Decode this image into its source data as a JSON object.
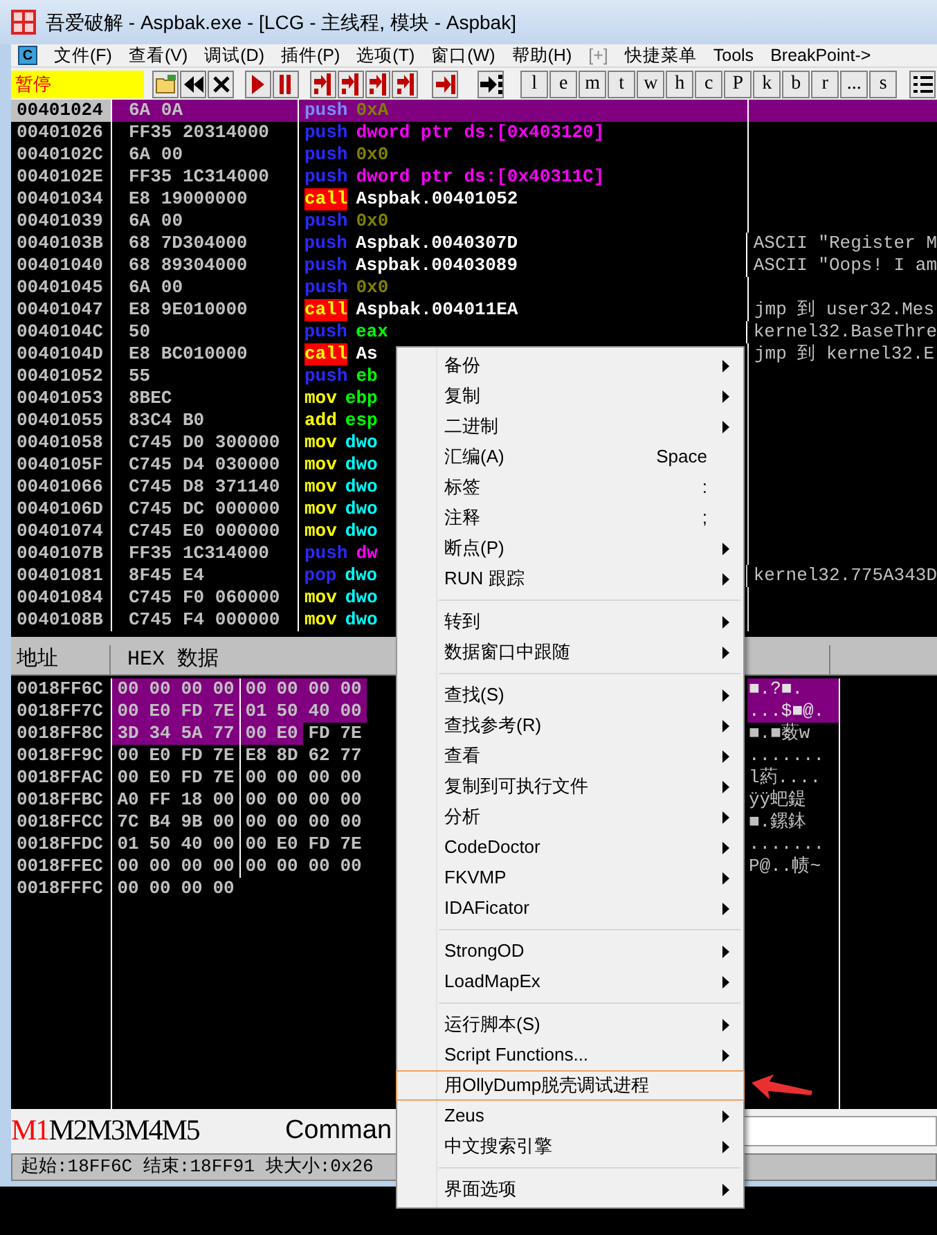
{
  "window": {
    "title": "吾爱破解 - Aspbak.exe - [LCG -  主线程, 模块 - Aspbak]"
  },
  "menu_bar": {
    "icon_letter": "C",
    "items": [
      {
        "label": "文件(F)",
        "disabled": false
      },
      {
        "label": "查看(V)",
        "disabled": false
      },
      {
        "label": "调试(D)",
        "disabled": false
      },
      {
        "label": "插件(P)",
        "disabled": false
      },
      {
        "label": "选项(T)",
        "disabled": false
      },
      {
        "label": "窗口(W)",
        "disabled": false
      },
      {
        "label": "帮助(H)",
        "disabled": false
      },
      {
        "label": "[+]",
        "disabled": true
      },
      {
        "label": "快捷菜单",
        "disabled": false
      },
      {
        "label": "Tools",
        "disabled": false
      },
      {
        "label": "BreakPoint->",
        "disabled": false
      }
    ]
  },
  "toolbar": {
    "status": "暂停",
    "buttons": [
      {
        "kind": "open"
      },
      {
        "kind": "rewind"
      },
      {
        "kind": "close"
      },
      {
        "kind": "run"
      },
      {
        "kind": "pause"
      },
      {
        "kind": "step_into"
      },
      {
        "kind": "step_over"
      },
      {
        "kind": "trace_into"
      },
      {
        "kind": "trace_over"
      },
      {
        "kind": "till_return"
      },
      {
        "kind": "goto"
      },
      {
        "kind": "letter",
        "label": "l"
      },
      {
        "kind": "letter",
        "label": "e"
      },
      {
        "kind": "letter",
        "label": "m"
      },
      {
        "kind": "letter",
        "label": "t"
      },
      {
        "kind": "letter",
        "label": "w"
      },
      {
        "kind": "letter",
        "label": "h"
      },
      {
        "kind": "letter",
        "label": "c"
      },
      {
        "kind": "letter",
        "label": "P"
      },
      {
        "kind": "letter",
        "label": "k"
      },
      {
        "kind": "letter",
        "label": "b"
      },
      {
        "kind": "letter",
        "label": "r"
      },
      {
        "kind": "letter",
        "label": "..."
      },
      {
        "kind": "letter",
        "label": "s"
      },
      {
        "kind": "list"
      }
    ]
  },
  "disassembly": {
    "rows": [
      {
        "address": "00401024",
        "hex": "6A 0A",
        "mnemonic": {
          "text": "push",
          "kind": "stack"
        },
        "operand": {
          "text": "0xA",
          "kind": "imm"
        },
        "selected": true
      },
      {
        "address": "00401026",
        "hex": "FF35 20314000",
        "mnemonic": {
          "text": "push",
          "kind": "stack"
        },
        "operand": {
          "text": "dword ptr ds:[0x403120]",
          "kind": "mem"
        },
        "selected": false
      },
      {
        "address": "0040102C",
        "hex": "6A 00",
        "mnemonic": {
          "text": "push",
          "kind": "stack"
        },
        "operand": {
          "text": "0x0",
          "kind": "imm"
        },
        "selected": false
      },
      {
        "address": "0040102E",
        "hex": "FF35 1C314000",
        "mnemonic": {
          "text": "push",
          "kind": "stack"
        },
        "operand": {
          "text": "dword ptr ds:[0x40311C]",
          "kind": "mem"
        },
        "selected": false
      },
      {
        "address": "00401034",
        "hex": "E8 19000000",
        "mnemonic": {
          "text": "call",
          "kind": "call"
        },
        "operand": {
          "text": "Aspbak.00401052",
          "kind": "label"
        },
        "selected": false
      },
      {
        "address": "00401039",
        "hex": "6A 00",
        "mnemonic": {
          "text": "push",
          "kind": "stack"
        },
        "operand": {
          "text": "0x0",
          "kind": "imm"
        },
        "selected": false
      },
      {
        "address": "0040103B",
        "hex": "68 7D304000",
        "mnemonic": {
          "text": "push",
          "kind": "stack"
        },
        "operand": {
          "text": "Aspbak.0040307D",
          "kind": "label"
        },
        "comment": "ASCII \"Register M",
        "selected": false
      },
      {
        "address": "00401040",
        "hex": "68 89304000",
        "mnemonic": {
          "text": "push",
          "kind": "stack"
        },
        "operand": {
          "text": "Aspbak.00403089",
          "kind": "label"
        },
        "comment": "ASCII \"Oops! I am",
        "selected": false
      },
      {
        "address": "00401045",
        "hex": "6A 00",
        "mnemonic": {
          "text": "push",
          "kind": "stack"
        },
        "operand": {
          "text": "0x0",
          "kind": "imm"
        },
        "selected": false
      },
      {
        "address": "00401047",
        "hex": "E8 9E010000",
        "mnemonic": {
          "text": "call",
          "kind": "call"
        },
        "operand": {
          "text": "Aspbak.004011EA",
          "kind": "label"
        },
        "comment": "jmp 到 user32.Mes",
        "selected": false
      },
      {
        "address": "0040104C",
        "hex": "50",
        "mnemonic": {
          "text": "push",
          "kind": "stack"
        },
        "operand": {
          "text": "eax",
          "kind": "reg"
        },
        "comment": "kernel32.BaseThre",
        "selected": false
      },
      {
        "address": "0040104D",
        "hex": "E8 BC010000",
        "mnemonic": {
          "text": "call",
          "kind": "call"
        },
        "operand": {
          "text": "As",
          "kind": "label"
        },
        "comment": "jmp 到 kernel32.E",
        "selected": false
      },
      {
        "address": "00401052",
        "hex": "55",
        "mnemonic": {
          "text": "push",
          "kind": "stack"
        },
        "operand": {
          "text": "eb",
          "kind": "reg"
        },
        "selected": false
      },
      {
        "address": "00401053",
        "hex": "8BEC",
        "mnemonic": {
          "text": "mov",
          "kind": "arith"
        },
        "operand": {
          "text": "ebp",
          "kind": "reg"
        },
        "selected": false
      },
      {
        "address": "00401055",
        "hex": "83C4 B0",
        "mnemonic": {
          "text": "add",
          "kind": "arith"
        },
        "operand": {
          "text": "esp",
          "kind": "reg"
        },
        "selected": false
      },
      {
        "address": "00401058",
        "hex": "C745 D0 300000",
        "mnemonic": {
          "text": "mov",
          "kind": "arith"
        },
        "operand": {
          "text": "dwo",
          "kind": "stack_mem"
        },
        "selected": false
      },
      {
        "address": "0040105F",
        "hex": "C745 D4 030000",
        "mnemonic": {
          "text": "mov",
          "kind": "arith"
        },
        "operand": {
          "text": "dwo",
          "kind": "stack_mem"
        },
        "selected": false
      },
      {
        "address": "00401066",
        "hex": "C745 D8 371140",
        "mnemonic": {
          "text": "mov",
          "kind": "arith"
        },
        "operand": {
          "text": "dwo",
          "kind": "stack_mem"
        },
        "selected": false
      },
      {
        "address": "0040106D",
        "hex": "C745 DC 000000",
        "mnemonic": {
          "text": "mov",
          "kind": "arith"
        },
        "operand": {
          "text": "dwo",
          "kind": "stack_mem"
        },
        "selected": false
      },
      {
        "address": "00401074",
        "hex": "C745 E0 000000",
        "mnemonic": {
          "text": "mov",
          "kind": "arith"
        },
        "operand": {
          "text": "dwo",
          "kind": "stack_mem"
        },
        "selected": false
      },
      {
        "address": "0040107B",
        "hex": "FF35 1C314000",
        "mnemonic": {
          "text": "push",
          "kind": "stack"
        },
        "operand": {
          "text": "dw",
          "kind": "mem"
        },
        "selected": false
      },
      {
        "address": "00401081",
        "hex": "8F45 E4",
        "mnemonic": {
          "text": "pop",
          "kind": "stack"
        },
        "operand": {
          "text": "dwo",
          "kind": "stack_mem"
        },
        "comment": "kernel32.775A343D",
        "selected": false
      },
      {
        "address": "00401084",
        "hex": "C745 F0 060000",
        "mnemonic": {
          "text": "mov",
          "kind": "arith"
        },
        "operand": {
          "text": "dwo",
          "kind": "stack_mem"
        },
        "selected": false
      },
      {
        "address": "0040108B",
        "hex": "C745 F4 000000",
        "mnemonic": {
          "text": "mov",
          "kind": "arith"
        },
        "operand": {
          "text": "dwo",
          "kind": "stack_mem"
        },
        "selected": false
      }
    ]
  },
  "dump": {
    "columns": [
      "地址",
      "HEX 数据"
    ],
    "rows": [
      {
        "address": "0018FF6C",
        "bytes": [
          {
            "v": "00",
            "selected": true
          },
          {
            "v": "00",
            "selected": true
          },
          {
            "v": "00",
            "selected": true
          },
          {
            "v": "00",
            "selected": true
          },
          {
            "v": "00",
            "selected": true
          },
          {
            "v": "00",
            "selected": true
          },
          {
            "v": "00",
            "selected": true
          },
          {
            "v": "00",
            "selected": true
          }
        ],
        "ascii": "■.?■.",
        "ascii_selected": true
      },
      {
        "address": "0018FF7C",
        "bytes": [
          {
            "v": "00",
            "selected": true
          },
          {
            "v": "E0",
            "selected": true
          },
          {
            "v": "FD",
            "selected": true
          },
          {
            "v": "7E",
            "selected": true
          },
          {
            "v": "01",
            "selected": true
          },
          {
            "v": "50",
            "selected": true
          },
          {
            "v": "40",
            "selected": true
          },
          {
            "v": "00",
            "selected": true
          }
        ],
        "ascii": "...$■@.",
        "ascii_selected": true
      },
      {
        "address": "0018FF8C",
        "bytes": [
          {
            "v": "3D",
            "selected": true
          },
          {
            "v": "34",
            "selected": true
          },
          {
            "v": "5A",
            "selected": true
          },
          {
            "v": "77",
            "selected": true
          },
          {
            "v": "00",
            "selected": true
          },
          {
            "v": "E0",
            "selected": true
          },
          {
            "v": "FD",
            "selected": false
          },
          {
            "v": "7E",
            "selected": false
          }
        ],
        "ascii": "■.■薮w",
        "ascii_selected": false
      },
      {
        "address": "0018FF9C",
        "bytes": [
          {
            "v": "00",
            "selected": false
          },
          {
            "v": "E0",
            "selected": false
          },
          {
            "v": "FD",
            "selected": false
          },
          {
            "v": "7E",
            "selected": false
          },
          {
            "v": "E8",
            "selected": false
          },
          {
            "v": "8D",
            "selected": false
          },
          {
            "v": "62",
            "selected": false
          },
          {
            "v": "77",
            "selected": false
          }
        ],
        "ascii": ".......",
        "ascii_selected": false
      },
      {
        "address": "0018FFAC",
        "bytes": [
          {
            "v": "00",
            "selected": false
          },
          {
            "v": "E0",
            "selected": false
          },
          {
            "v": "FD",
            "selected": false
          },
          {
            "v": "7E",
            "selected": false
          },
          {
            "v": "00",
            "selected": false
          },
          {
            "v": "00",
            "selected": false
          },
          {
            "v": "00",
            "selected": false
          },
          {
            "v": "00",
            "selected": false
          }
        ],
        "ascii": "l葯....",
        "ascii_selected": false
      },
      {
        "address": "0018FFBC",
        "bytes": [
          {
            "v": "A0",
            "selected": false
          },
          {
            "v": "FF",
            "selected": false
          },
          {
            "v": "18",
            "selected": false
          },
          {
            "v": "00",
            "selected": false
          },
          {
            "v": "00",
            "selected": false
          },
          {
            "v": "00",
            "selected": false
          },
          {
            "v": "00",
            "selected": false
          },
          {
            "v": "00",
            "selected": false
          }
        ],
        "ascii": "ÿÿ蚆鍉",
        "ascii_selected": false
      },
      {
        "address": "0018FFCC",
        "bytes": [
          {
            "v": "7C",
            "selected": false
          },
          {
            "v": "B4",
            "selected": false
          },
          {
            "v": "9B",
            "selected": false
          },
          {
            "v": "00",
            "selected": false
          },
          {
            "v": "00",
            "selected": false
          },
          {
            "v": "00",
            "selected": false
          },
          {
            "v": "00",
            "selected": false
          },
          {
            "v": "00",
            "selected": false
          }
        ],
        "ascii": "■.鏍鉢",
        "ascii_selected": false
      },
      {
        "address": "0018FFDC",
        "bytes": [
          {
            "v": "01",
            "selected": false
          },
          {
            "v": "50",
            "selected": false
          },
          {
            "v": "40",
            "selected": false
          },
          {
            "v": "00",
            "selected": false
          },
          {
            "v": "00",
            "selected": false
          },
          {
            "v": "E0",
            "selected": false
          },
          {
            "v": "FD",
            "selected": false
          },
          {
            "v": "7E",
            "selected": false
          }
        ],
        "ascii": ".......",
        "ascii_selected": false
      },
      {
        "address": "0018FFEC",
        "bytes": [
          {
            "v": "00",
            "selected": false
          },
          {
            "v": "00",
            "selected": false
          },
          {
            "v": "00",
            "selected": false
          },
          {
            "v": "00",
            "selected": false
          },
          {
            "v": "00",
            "selected": false
          },
          {
            "v": "00",
            "selected": false
          },
          {
            "v": "00",
            "selected": false
          },
          {
            "v": "00",
            "selected": false
          }
        ],
        "ascii": "P@..帻~",
        "ascii_selected": false
      },
      {
        "address": "0018FFFC",
        "bytes": [
          {
            "v": "00",
            "selected": false
          },
          {
            "v": "00",
            "selected": false
          },
          {
            "v": "00",
            "selected": false
          },
          {
            "v": "00",
            "selected": false
          }
        ]
      }
    ]
  },
  "command_bar": {
    "marks": [
      {
        "label": "M1",
        "selected": true
      },
      {
        "label": "M2",
        "selected": false
      },
      {
        "label": "M3",
        "selected": false
      },
      {
        "label": "M4",
        "selected": false
      },
      {
        "label": "M5",
        "selected": false
      }
    ],
    "command": "Comman"
  },
  "status_bar": "起始:18FF6C 结束:18FF91 块大小:0x26",
  "context_menu": {
    "groups": [
      [
        {
          "label": "备份",
          "submenu": true,
          "highlighted": false
        },
        {
          "label": "复制",
          "submenu": true,
          "highlighted": false
        },
        {
          "label": "二进制",
          "submenu": true,
          "highlighted": false
        },
        {
          "label": "汇编(A)",
          "shortcut": "Space",
          "submenu": false,
          "highlighted": false
        },
        {
          "label": "标签",
          "shortcut": ":",
          "submenu": false,
          "highlighted": false
        },
        {
          "label": "注释",
          "shortcut": ";",
          "submenu": false,
          "highlighted": false
        },
        {
          "label": "断点(P)",
          "submenu": true,
          "highlighted": false
        },
        {
          "label": "RUN 跟踪",
          "submenu": true,
          "highlighted": false
        }
      ],
      [
        {
          "label": "转到",
          "submenu": true,
          "highlighted": false
        },
        {
          "label": "数据窗口中跟随",
          "submenu": true,
          "highlighted": false
        }
      ],
      [
        {
          "label": "查找(S)",
          "submenu": true,
          "highlighted": false
        },
        {
          "label": "查找参考(R)",
          "submenu": true,
          "highlighted": false
        },
        {
          "label": "查看",
          "submenu": true,
          "highlighted": false
        },
        {
          "label": "复制到可执行文件",
          "submenu": true,
          "highlighted": false
        },
        {
          "label": "分析",
          "submenu": true,
          "highlighted": false
        },
        {
          "label": "CodeDoctor",
          "submenu": true,
          "highlighted": false
        },
        {
          "label": "FKVMP",
          "submenu": true,
          "highlighted": false
        },
        {
          "label": "IDAFicator",
          "submenu": true,
          "highlighted": false
        }
      ],
      [
        {
          "label": "StrongOD",
          "submenu": true,
          "highlighted": false
        },
        {
          "label": "LoadMapEx",
          "submenu": true,
          "highlighted": false
        }
      ],
      [
        {
          "label": "运行脚本(S)",
          "submenu": true,
          "highlighted": false
        },
        {
          "label": "Script Functions...",
          "submenu": true,
          "highlighted": false
        },
        {
          "label": "用OllyDump脱壳调试进程",
          "submenu": false,
          "highlighted": true
        },
        {
          "label": "Zeus",
          "submenu": true,
          "highlighted": false
        },
        {
          "label": "中文搜索引擎",
          "submenu": true,
          "highlighted": false
        }
      ],
      [
        {
          "label": "界面选项",
          "submenu": true,
          "highlighted": false
        }
      ]
    ]
  }
}
